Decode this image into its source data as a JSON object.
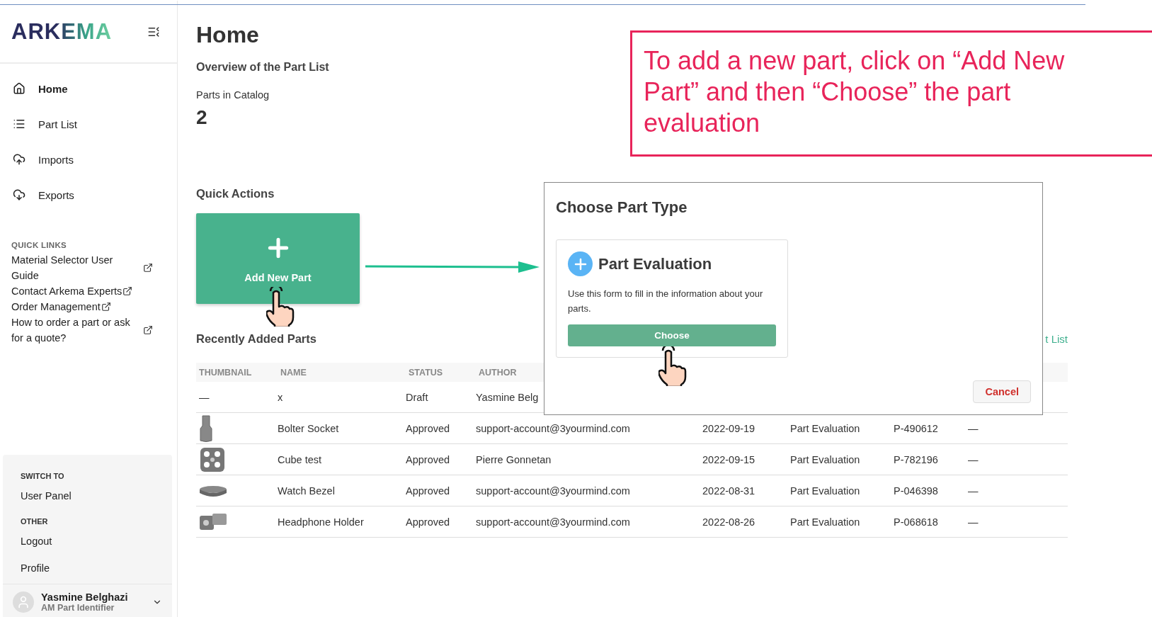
{
  "sidebar": {
    "logo": "ARKEMA",
    "nav": [
      {
        "label": "Home",
        "selected": true
      },
      {
        "label": "Part List",
        "selected": false
      },
      {
        "label": "Imports",
        "selected": false
      },
      {
        "label": "Exports",
        "selected": false
      }
    ],
    "quick_links": {
      "heading": "QUICK LINKS",
      "items": [
        "Material Selector User Guide",
        "Contact Arkema Experts",
        "Order Management",
        "How to order a part or ask for a quote?"
      ]
    },
    "panel_sections": [
      {
        "heading": "SWITCH TO",
        "items": [
          "User Panel"
        ]
      },
      {
        "heading": "OTHER",
        "items": [
          "Logout",
          "Profile"
        ]
      }
    ],
    "user": {
      "name": "Yasmine Belghazi",
      "role": "AM Part Identifier"
    }
  },
  "main": {
    "title": "Home",
    "subtitle": "Overview of the Part List",
    "stat_label": "Parts in Catalog",
    "stat_value": "2",
    "quick_actions": "Quick Actions",
    "add_button": "Add New Part",
    "recent_heading": "Recently Added Parts",
    "view_link": "t List",
    "table": {
      "columns": [
        "THUMBNAIL",
        "NAME",
        "STATUS",
        "AUTHOR"
      ],
      "rows": [
        {
          "kind": "text",
          "cells": [
            "—",
            "x",
            "Draft",
            "Yasmine Belg"
          ]
        },
        {
          "kind": "socket",
          "cells": [
            "",
            "Bolter Socket",
            "Approved",
            "support-account@3yourmind.com",
            "2022-09-19",
            "Part Evaluation",
            "P-490612",
            "—"
          ]
        },
        {
          "kind": "lattice",
          "cells": [
            "",
            "Cube test",
            "Approved",
            "Pierre Gonnetan",
            "2022-09-15",
            "Part Evaluation",
            "P-782196",
            "—"
          ]
        },
        {
          "kind": "ring",
          "cells": [
            "",
            "Watch Bezel",
            "Approved",
            "support-account@3yourmind.com",
            "2022-08-31",
            "Part Evaluation",
            "P-046398",
            "—"
          ]
        },
        {
          "kind": "holder",
          "cells": [
            "",
            "Headphone Holder",
            "Approved",
            "support-account@3yourmind.com",
            "2022-08-26",
            "Part Evaluation",
            "P-068618",
            "—"
          ]
        }
      ]
    }
  },
  "dialog": {
    "title": "Choose Part Type",
    "option": {
      "title": "Part Evaluation",
      "description": "Use this form to fill in the information about your parts.",
      "button": "Choose"
    },
    "cancel": "Cancel"
  },
  "annotation": {
    "text": "To add a new part, click on “Add New Part” and then “Choose” the part evaluation"
  }
}
